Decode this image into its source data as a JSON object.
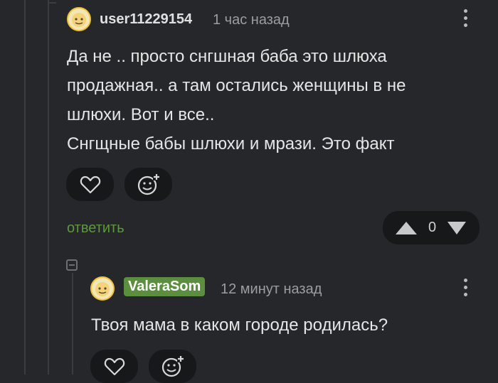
{
  "comment1": {
    "username": "user11229154",
    "time": "1 час назад",
    "text_lines": [
      "Да не .. просто снгшная баба это шлюха",
      "продажная.. а там остались женщины в не",
      "шлюхи. Вот и все..",
      "Снгщные бабы шлюхи и мрази. Это факт"
    ],
    "reply_label": "ответить",
    "rating": "0"
  },
  "comment2": {
    "username": "ValeraSom",
    "time": "12 минут назад",
    "text": "Твоя мама в каком городе родилась?"
  },
  "colors": {
    "background": "#25272a",
    "pill_background": "#17181a",
    "reply_green": "#5c9a3a",
    "badge_green": "#5b8e3e"
  },
  "icons": [
    "heart-icon",
    "add-emoji-icon",
    "vertical-dots-icon",
    "upvote-icon",
    "downvote-icon",
    "collapse-icon"
  ]
}
